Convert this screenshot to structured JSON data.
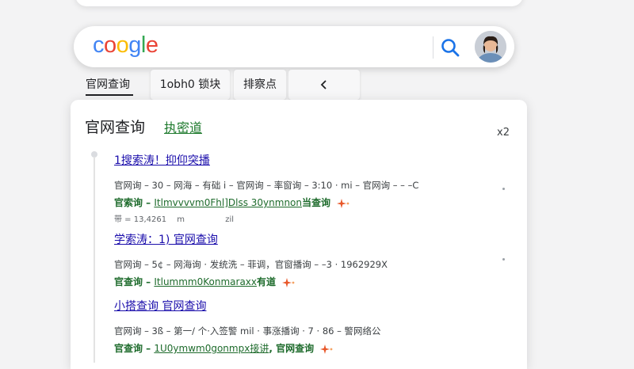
{
  "search": {
    "logo_letters": [
      "c",
      "o",
      "o",
      "g",
      "l",
      "e"
    ],
    "query": ""
  },
  "tabs": [
    {
      "label": "官网查询"
    },
    {
      "label": "1obh0 锁块"
    },
    {
      "label": "排察点"
    }
  ],
  "card": {
    "title": "官网查询",
    "subtitle": "执密道",
    "count": "x2"
  },
  "results": [
    {
      "title": "1搜索涛！抑仰突播",
      "snippet": "官网询 – 30 – 网海 – 有础 i – 官网询 – 率窗询 – 3:10 · mi – 官网询 – – –C",
      "url_prefix": "官索询 – ",
      "url_text": "Itlmvvvvm0Fhl]Dlss 30ynmnon",
      "url_suffix": "当查询",
      "meta_a": "带 = 13,4261",
      "meta_b": "m",
      "meta_c": "zil"
    },
    {
      "title": "学索涛：1) 官网查询",
      "snippet": "官网询 – 5¢ – 网海询 · 发统洗 – 菲调，官窗播询 – –3 · 1962929X",
      "url_prefix": "官查询 – ",
      "url_text": "Itlummm0Konmaraxx",
      "url_suffix": "有道",
      "meta_a": "",
      "meta_b": "",
      "meta_c": ""
    },
    {
      "title": "小搭查询  官网查询",
      "snippet": "官网询 – 3ß – 第一/ 个·入签警 mil · 事涨播询 · 7 · 86 – 警网络公",
      "url_prefix": "官查询 – ",
      "url_text": "1U0ymwm0gonmpx接讲",
      "url_suffix": ", 官网查询",
      "meta_a": "",
      "meta_b": "",
      "meta_c": ""
    }
  ],
  "colors": {
    "link": "#1a0dab",
    "url_green": "#1e6b2c",
    "sparkle_orange": "#e8582a"
  },
  "icons": {
    "search": "magnifier-icon",
    "sparkle": "sparkle-icon",
    "chevron": "chevron-left-icon"
  }
}
